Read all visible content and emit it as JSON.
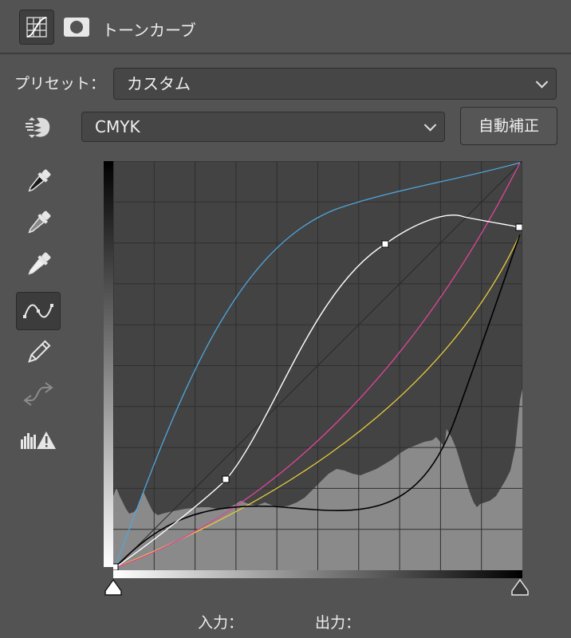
{
  "header": {
    "title": "トーンカーブ",
    "icons": [
      "curves-adjustment-icon",
      "layer-mask-icon"
    ]
  },
  "preset": {
    "label": "プリセット：",
    "value": "カスタム"
  },
  "channel": {
    "value": "CMYK"
  },
  "auto_button": {
    "label": "自動補正"
  },
  "tools": [
    "target-adjustment-icon",
    "black-point-eyedropper-icon",
    "gray-point-eyedropper-icon",
    "white-point-eyedropper-icon",
    "curve-point-icon",
    "pencil-icon",
    "smooth-icon",
    "clipping-warning-icon"
  ],
  "colors": {
    "panel_bg": "#535353",
    "graph_bg": "#434343",
    "histogram": "#8a8a8a",
    "cyan_curve": "#4fa6de",
    "magenta_curve": "#e0449a",
    "yellow_curve": "#e6cc3a",
    "composite_curve": "#ffffff",
    "black_curve": "#000000"
  },
  "footer": {
    "input_label": "入力：",
    "output_label": "出力："
  }
}
